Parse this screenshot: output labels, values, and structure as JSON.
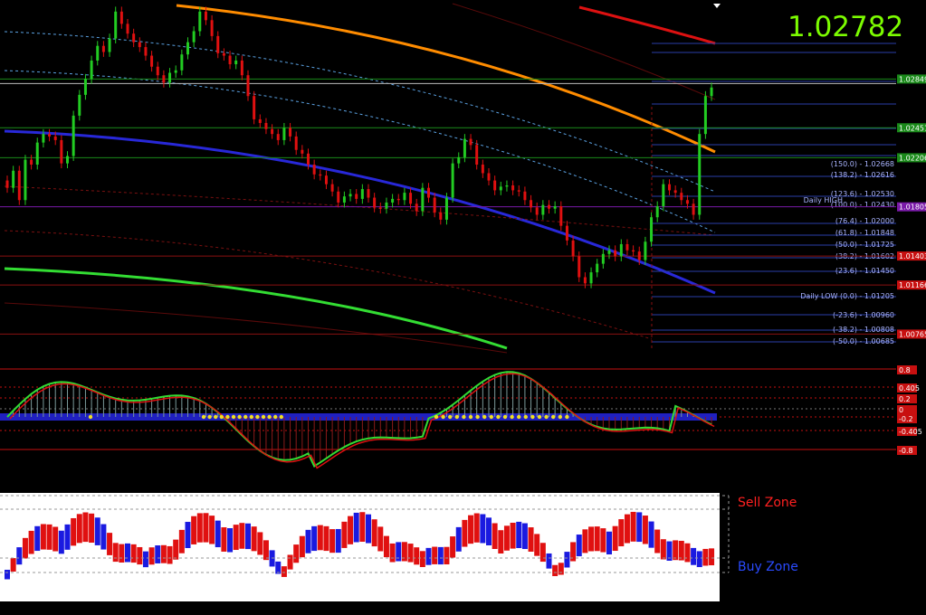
{
  "header": {
    "last_price": "1.02782"
  },
  "colors": {
    "background": "#000000",
    "bull": "#22cc22",
    "bear": "#e01010",
    "ma_blue": "#2828d8",
    "ma_orange": "#ff8c00",
    "ma_green": "#33dd33",
    "fib_line": "#2a3ea8",
    "sell_zone": "#ff2020",
    "buy_zone": "#2a4bff"
  },
  "fib_labels": [
    "(150.0) - 1.02668",
    "(138.2) - 1.02616",
    "(123.6) - 1.02530",
    "(100.0) - 1.02430",
    "(76.4) - 1.02000",
    "(61.8) - 1.01848",
    "(50.0) - 1.01725",
    "(38.2) - 1.01602",
    "(23.6) - 1.01450",
    "(-23.6) - 1.00960",
    "(-38.2) - 1.00808",
    "(-50.0) - 1.00685"
  ],
  "daily_high": "Daily HIGH",
  "daily_low": "Daily LOW (0.0) - 1.01205",
  "price_tags": [
    {
      "text": "1.02849",
      "bg": "#1a8a1a"
    },
    {
      "text": "1.02451",
      "bg": "#1a8a1a"
    },
    {
      "text": "1.02206",
      "bg": "#1a8a1a"
    },
    {
      "text": "1.01805",
      "bg": "#7a1aa8"
    },
    {
      "text": "1.01403",
      "bg": "#c81010"
    },
    {
      "text": "1.01166",
      "bg": "#c81010"
    },
    {
      "text": "1.00765",
      "bg": "#c81010"
    }
  ],
  "osc_levels": [
    {
      "text": "0.8",
      "bg": "#c81010"
    },
    {
      "text": "0.405",
      "bg": "#c81010"
    },
    {
      "text": "0.2",
      "bg": "#c81010"
    },
    {
      "text": "0",
      "bg": "#c81010"
    },
    {
      "text": "-0.2",
      "bg": "#c81010"
    },
    {
      "text": "-0.405",
      "bg": "#c81010"
    },
    {
      "text": "-0.8",
      "bg": "#c81010"
    }
  ],
  "zones": {
    "sell": "Sell Zone",
    "buy": "Buy Zone"
  },
  "chart_data": {
    "type": "candlestick",
    "closes": [
      1.0196,
      1.021,
      1.0186,
      1.0219,
      1.0215,
      1.0233,
      1.024,
      1.0238,
      1.0235,
      1.0216,
      1.0222,
      1.0255,
      1.0272,
      1.0285,
      1.03,
      1.0312,
      1.0307,
      1.0318,
      1.034,
      1.033,
      1.0322,
      1.0315,
      1.0311,
      1.0304,
      1.0295,
      1.0288,
      1.0282,
      1.029,
      1.0292,
      1.0305,
      1.0315,
      1.0324,
      1.034,
      1.0333,
      1.032,
      1.0306,
      1.0304,
      1.0297,
      1.03,
      1.0288,
      1.0271,
      1.0252,
      1.0249,
      1.0244,
      1.024,
      1.0235,
      1.0245,
      1.0238,
      1.0227,
      1.0224,
      1.0215,
      1.0207,
      1.0206,
      1.0199,
      1.0193,
      1.0184,
      1.0189,
      1.0191,
      1.0187,
      1.0195,
      1.0188,
      1.018,
      1.0179,
      1.0184,
      1.0187,
      1.0186,
      1.0192,
      1.0183,
      1.0177,
      1.0196,
      1.0188,
      1.0176,
      1.017,
      1.0188,
      1.0216,
      1.0221,
      1.0236,
      1.0231,
      1.0215,
      1.0208,
      1.0202,
      1.0194,
      1.0197,
      1.0198,
      1.0194,
      1.0193,
      1.0186,
      1.018,
      1.0174,
      1.0182,
      1.0179,
      1.0181,
      1.0165,
      1.0153,
      1.014,
      1.0123,
      1.0118,
      1.0127,
      1.0134,
      1.0142,
      1.0145,
      1.014,
      1.015,
      1.0145,
      1.0144,
      1.0137,
      1.0152,
      1.0172,
      1.0181,
      1.0199,
      1.0194,
      1.0192,
      1.0186,
      1.0183,
      1.0174,
      1.024,
      1.0271,
      1.0278
    ]
  }
}
